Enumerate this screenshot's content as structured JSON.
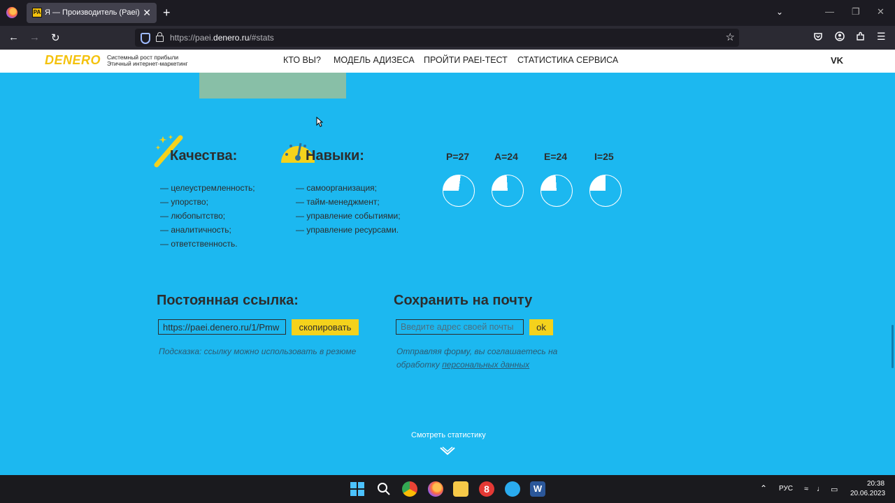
{
  "browser": {
    "tab_title": "Я — Производитель (Paei)",
    "url_prefix": "https://paei.",
    "url_domain": "denero.ru",
    "url_path": "/#stats",
    "tab_close": "✕",
    "new_tab": "+"
  },
  "site": {
    "logo": "DENERO",
    "tagline_1": "Системный рост прибыли",
    "tagline_2": "Этичный интернет-маркетинг",
    "menu": [
      "КТО ВЫ?",
      "МОДЕЛЬ АДИЗЕСА",
      "ПРОЙТИ PAEI-ТЕСТ",
      "СТАТИСТИКА СЕРВИСА"
    ],
    "vk": "VK"
  },
  "qualities": {
    "title": "Качества:",
    "items": [
      "— целеустремленность;",
      "— упорство;",
      "— любопытство;",
      "— аналитичность;",
      "— ответственность."
    ]
  },
  "skills": {
    "title": "Навыки:",
    "items": [
      "— самоорганизация;",
      "— тайм-менеджмент;",
      "— управление событиями;",
      "— управление ресурсами."
    ]
  },
  "stats": [
    {
      "label": "P=27",
      "value": 27
    },
    {
      "label": "A=24",
      "value": 24
    },
    {
      "label": "E=24",
      "value": 24
    },
    {
      "label": "I=25",
      "value": 25
    }
  ],
  "permalink": {
    "title": "Постоянная ссылка:",
    "value": "https://paei.denero.ru/1/Pmw",
    "copy_label": "скопировать",
    "hint": "Подсказка: ссылку можно использовать в резюме"
  },
  "email": {
    "title": "Сохранить на почту",
    "placeholder": "Введите адрес своей почты",
    "ok_label": "ok",
    "hint_1": "Отправляя форму, вы соглашаетесь на",
    "hint_2": "обработку ",
    "hint_link": "персональных данных"
  },
  "footer": {
    "see_stats": "Смотреть статистику"
  },
  "taskbar": {
    "lang": "РУС",
    "time": "20:38",
    "date": "20.06.2023"
  },
  "colors": {
    "page_bg": "#1cb8f0",
    "accent_yellow": "#f4d21c"
  }
}
